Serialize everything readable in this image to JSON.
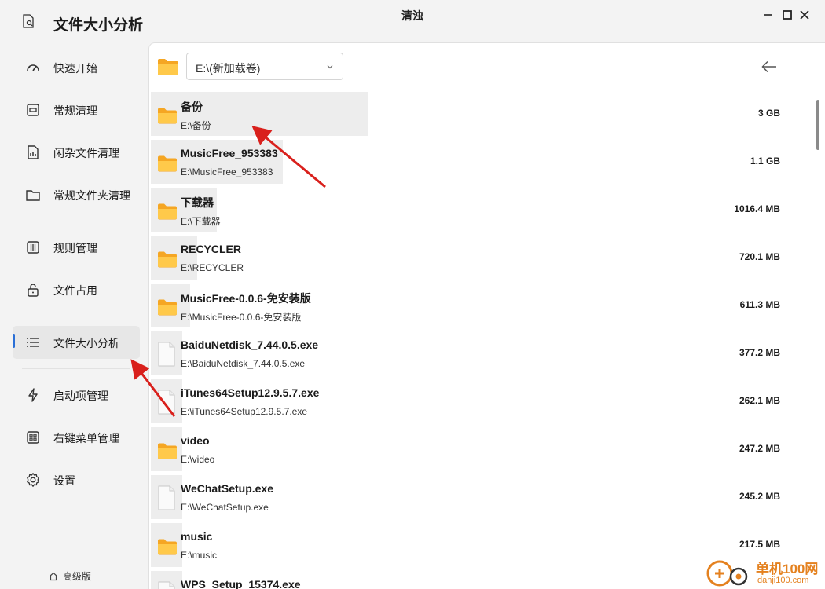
{
  "app": {
    "title": "文件大小分析",
    "window_title": "清浊"
  },
  "sidebar": {
    "items": [
      {
        "label": "快速开始",
        "icon": "speedometer-icon"
      },
      {
        "label": "常规清理",
        "icon": "cleanup-icon"
      },
      {
        "label": "闲杂文件清理",
        "icon": "file-chart-icon"
      },
      {
        "label": "常规文件夹清理",
        "icon": "folder-icon"
      },
      {
        "label": "规则管理",
        "icon": "rules-icon"
      },
      {
        "label": "文件占用",
        "icon": "lock-icon"
      },
      {
        "label": "文件大小分析",
        "icon": "list-icon"
      },
      {
        "label": "启动项管理",
        "icon": "lightning-icon"
      },
      {
        "label": "右键菜单管理",
        "icon": "grid-icon"
      },
      {
        "label": "设置",
        "icon": "gear-icon"
      }
    ],
    "active_index": 6,
    "premium_label": "高级版"
  },
  "toolbar": {
    "path_value": "E:\\(新加载卷)"
  },
  "files": [
    {
      "name": "备份",
      "path": "E:\\备份",
      "size": "3 GB",
      "type": "folder",
      "highlight": 0.33
    },
    {
      "name": "MusicFree_953383",
      "path": "E:\\MusicFree_953383",
      "size": "1.1 GB",
      "type": "folder",
      "highlight": 0.2
    },
    {
      "name": "下载器",
      "path": "E:\\下载器",
      "size": "1016.4 MB",
      "type": "folder",
      "highlight": 0.1
    },
    {
      "name": "RECYCLER",
      "path": "E:\\RECYCLER",
      "size": "720.1 MB",
      "type": "folder",
      "highlight": 0.07
    },
    {
      "name": "MusicFree-0.0.6-免安装版",
      "path": "E:\\MusicFree-0.0.6-免安装版",
      "size": "611.3 MB",
      "type": "folder",
      "highlight": 0.06
    },
    {
      "name": "BaiduNetdisk_7.44.0.5.exe",
      "path": "E:\\BaiduNetdisk_7.44.0.5.exe",
      "size": "377.2 MB",
      "type": "file",
      "highlight": 0.04
    },
    {
      "name": "iTunes64Setup12.9.5.7.exe",
      "path": "E:\\iTunes64Setup12.9.5.7.exe",
      "size": "262.1 MB",
      "type": "file",
      "highlight": 0.03
    },
    {
      "name": "video",
      "path": "E:\\video",
      "size": "247.2 MB",
      "type": "folder",
      "highlight": 0.03
    },
    {
      "name": "WeChatSetup.exe",
      "path": "E:\\WeChatSetup.exe",
      "size": "245.2 MB",
      "type": "file",
      "highlight": 0.03
    },
    {
      "name": "music",
      "path": "E:\\music",
      "size": "217.5 MB",
      "type": "folder",
      "highlight": 0.02
    },
    {
      "name": "WPS_Setup_15374.exe",
      "path": "",
      "size": "",
      "type": "file",
      "highlight": 0.02
    }
  ],
  "watermark": {
    "text": "单机100网",
    "url": "danji100.com"
  },
  "colors": {
    "accent": "#2a6fd6",
    "folder": "#f7b52c",
    "arrow": "#d9201c",
    "watermark": "#e4811f"
  }
}
